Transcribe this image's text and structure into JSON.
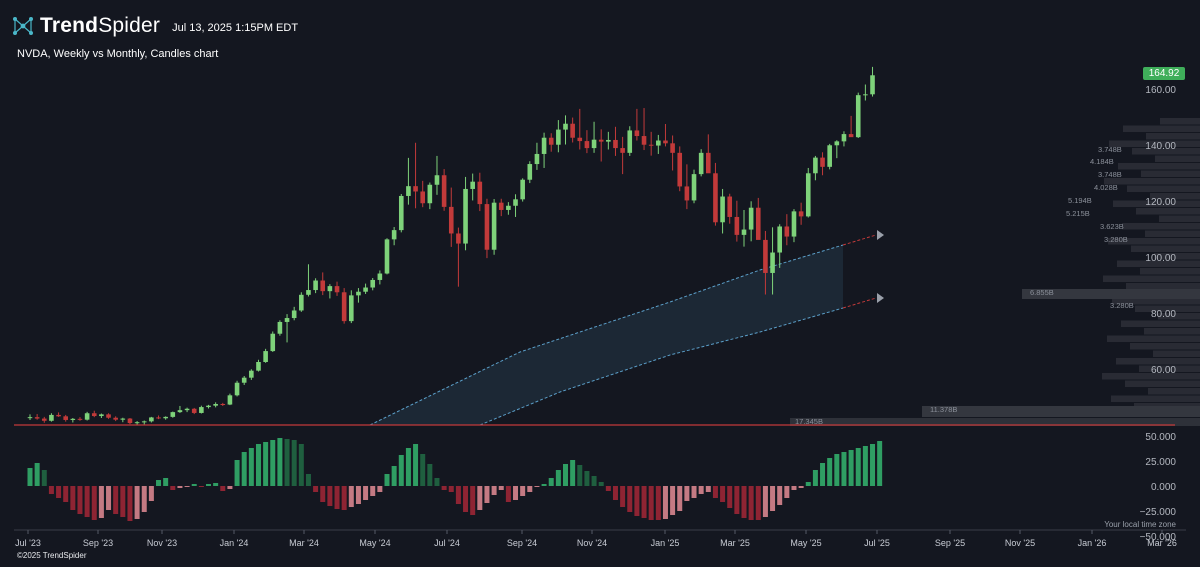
{
  "brand": {
    "name_prefix": "Trend",
    "name_suffix": "Spider",
    "icon": "spider-network-icon"
  },
  "header": {
    "datetime": "Jul 13, 2025 1:15PM EDT",
    "subtitle": "NVDA, Weekly vs Monthly, Candles chart"
  },
  "footer": {
    "copyright": "©2025 TrendSpider",
    "timezone_note": "Your local time zone"
  },
  "colors": {
    "up": "#7ed27a",
    "down": "#c23a3a",
    "hist_up": "#2f9e63",
    "hist_up_fade": "#1f5f3f",
    "hist_down": "#8e2433",
    "hist_down_fade": "#c47a83",
    "channel": "#1d2b3a",
    "volume_profile": "#2b2e36"
  },
  "chart_data": {
    "type": "candlestick",
    "title": "NVDA, Weekly vs Monthly, Candles chart",
    "last_price": "164.92",
    "ylim": [
      40,
      170
    ],
    "y_ticks": [
      "160.00",
      "140.00",
      "120.00",
      "100.00",
      "80.00",
      "60.00"
    ],
    "x_ticks": [
      "Jul '23",
      "Sep '23",
      "Nov '23",
      "Jan '24",
      "Mar '24",
      "May '24",
      "Jul '24",
      "Sep '24",
      "Nov '24",
      "Jan '25",
      "Mar '25",
      "May '25",
      "Jul '25",
      "Sep '25",
      "Nov '25",
      "Jan '26",
      "Mar '26"
    ],
    "candles": [
      [
        42.5,
        43.8,
        41.8,
        42.8
      ],
      [
        42.8,
        43.9,
        41.9,
        42.3
      ],
      [
        42.3,
        42.9,
        40.8,
        41.5
      ],
      [
        41.5,
        44.2,
        41.2,
        43.6
      ],
      [
        43.6,
        44.5,
        42.9,
        43.1
      ],
      [
        43.1,
        43.6,
        41.2,
        41.8
      ],
      [
        41.8,
        42.5,
        40.9,
        42.2
      ],
      [
        42.2,
        42.8,
        41.5,
        41.9
      ],
      [
        41.9,
        44.7,
        41.6,
        44.2
      ],
      [
        44.2,
        45.1,
        42.8,
        43.2
      ],
      [
        43.2,
        44.1,
        42.5,
        43.8
      ],
      [
        43.8,
        44.2,
        42.2,
        42.6
      ],
      [
        42.6,
        43.1,
        41.4,
        41.9
      ],
      [
        41.9,
        42.6,
        41.0,
        42.3
      ],
      [
        42.3,
        42.5,
        40.3,
        40.7
      ],
      [
        40.7,
        41.4,
        40.1,
        41.0
      ],
      [
        41.0,
        41.6,
        40.2,
        41.3
      ],
      [
        41.3,
        42.9,
        40.9,
        42.7
      ],
      [
        42.7,
        43.4,
        42.1,
        42.4
      ],
      [
        42.4,
        43.1,
        41.9,
        42.9
      ],
      [
        42.9,
        44.8,
        42.6,
        44.6
      ],
      [
        44.6,
        46.8,
        44.3,
        45.3
      ],
      [
        45.3,
        46.2,
        44.6,
        45.8
      ],
      [
        45.8,
        46.1,
        43.9,
        44.3
      ],
      [
        44.3,
        46.9,
        44.1,
        46.4
      ],
      [
        46.4,
        47.2,
        45.9,
        46.9
      ],
      [
        46.9,
        48.1,
        46.3,
        47.5
      ],
      [
        47.5,
        47.9,
        46.8,
        47.3
      ],
      [
        47.3,
        51.2,
        47.1,
        50.6
      ],
      [
        50.6,
        55.8,
        50.2,
        55.1
      ],
      [
        55.1,
        57.5,
        54.3,
        56.9
      ],
      [
        56.9,
        59.9,
        56.1,
        59.4
      ],
      [
        59.4,
        63.3,
        59.1,
        62.5
      ],
      [
        62.5,
        67.2,
        62.2,
        66.4
      ],
      [
        66.4,
        73.4,
        66.1,
        72.6
      ],
      [
        72.6,
        77.4,
        71.9,
        76.8
      ],
      [
        76.8,
        79.6,
        69.5,
        78.2
      ],
      [
        78.2,
        82.2,
        77.4,
        80.9
      ],
      [
        80.9,
        87.4,
        80.4,
        86.5
      ],
      [
        86.5,
        97.4,
        85.9,
        88.2
      ],
      [
        88.2,
        92.4,
        87.1,
        91.6
      ],
      [
        91.6,
        94.5,
        86.4,
        87.8
      ],
      [
        87.8,
        90.3,
        85.2,
        89.6
      ],
      [
        89.6,
        91.2,
        86.1,
        87.4
      ],
      [
        87.4,
        88.9,
        76.2,
        77.1
      ],
      [
        77.1,
        88.1,
        76.4,
        86.3
      ],
      [
        86.3,
        88.9,
        83.7,
        87.6
      ],
      [
        87.6,
        90.5,
        86.8,
        89.1
      ],
      [
        89.1,
        92.5,
        88.1,
        91.8
      ],
      [
        91.8,
        95.2,
        90.2,
        94.1
      ],
      [
        94.1,
        106.7,
        93.8,
        106.3
      ],
      [
        106.3,
        110.7,
        104.2,
        109.6
      ],
      [
        109.6,
        122.5,
        108.8,
        121.8
      ],
      [
        121.8,
        135.4,
        118.7,
        125.3
      ],
      [
        125.3,
        140.8,
        117.4,
        123.4
      ],
      [
        123.4,
        127.2,
        117.8,
        119.2
      ],
      [
        119.2,
        126.6,
        117.1,
        125.8
      ],
      [
        125.8,
        136.1,
        122.2,
        129.2
      ],
      [
        129.2,
        131.4,
        116.5,
        117.9
      ],
      [
        117.9,
        124.8,
        103.6,
        108.4
      ],
      [
        108.4,
        110.5,
        89.4,
        104.8
      ],
      [
        104.8,
        128.6,
        102.4,
        124.3
      ],
      [
        124.3,
        129.8,
        120.2,
        126.9
      ],
      [
        126.9,
        130.1,
        116.4,
        118.9
      ],
      [
        118.9,
        120.8,
        99.6,
        102.6
      ],
      [
        102.6,
        120.7,
        100.8,
        119.4
      ],
      [
        119.4,
        120.8,
        114.6,
        116.8
      ],
      [
        116.8,
        119.6,
        115.1,
        118.3
      ],
      [
        118.3,
        122.4,
        114.3,
        120.6
      ],
      [
        120.6,
        128.1,
        119.8,
        127.6
      ],
      [
        127.6,
        134.2,
        126.4,
        133.2
      ],
      [
        133.2,
        140.8,
        131.1,
        136.8
      ],
      [
        136.8,
        144.4,
        131.8,
        142.6
      ],
      [
        142.6,
        144.2,
        137.6,
        140.1
      ],
      [
        140.1,
        148.9,
        137.4,
        145.5
      ],
      [
        145.5,
        150.6,
        140.2,
        147.6
      ],
      [
        147.6,
        149.8,
        140.9,
        142.6
      ],
      [
        142.6,
        152.9,
        138.4,
        141.4
      ],
      [
        141.4,
        145.3,
        137.1,
        138.9
      ],
      [
        138.9,
        148.3,
        137.2,
        141.9
      ],
      [
        141.9,
        145.6,
        134.1,
        141.2
      ],
      [
        141.2,
        144.7,
        138.4,
        141.8
      ],
      [
        141.8,
        146.5,
        136.1,
        138.9
      ],
      [
        138.9,
        142.9,
        129.6,
        137.2
      ],
      [
        137.2,
        146.7,
        136.1,
        145.2
      ],
      [
        145.2,
        152.9,
        141.6,
        143.2
      ],
      [
        143.2,
        153.2,
        138.2,
        140.1
      ],
      [
        140.1,
        144.7,
        136.2,
        139.8
      ],
      [
        139.8,
        143.6,
        136.8,
        141.6
      ],
      [
        141.6,
        147.5,
        139.5,
        140.6
      ],
      [
        140.6,
        143.4,
        130.9,
        137.2
      ],
      [
        137.2,
        139.5,
        123.5,
        125.2
      ],
      [
        125.2,
        133.1,
        117.1,
        120.2
      ],
      [
        120.2,
        131.2,
        119.2,
        129.6
      ],
      [
        129.6,
        138.5,
        128.8,
        137.2
      ],
      [
        137.2,
        143.8,
        136.1,
        129.9
      ],
      [
        129.9,
        133.6,
        111.2,
        112.4
      ],
      [
        112.4,
        124.3,
        108.4,
        121.6
      ],
      [
        121.6,
        122.6,
        111.9,
        114.3
      ],
      [
        114.3,
        120.1,
        105.5,
        107.9
      ],
      [
        107.9,
        116.8,
        103.7,
        109.8
      ],
      [
        109.8,
        119.9,
        105.6,
        117.6
      ],
      [
        117.6,
        121.1,
        107.2,
        106.1
      ],
      [
        106.1,
        109.3,
        86.6,
        94.3
      ],
      [
        94.3,
        110.6,
        86.6,
        101.6
      ],
      [
        101.6,
        111.7,
        96.1,
        110.9
      ],
      [
        110.9,
        115.3,
        104.2,
        107.3
      ],
      [
        107.3,
        117.1,
        105.3,
        116.3
      ],
      [
        116.3,
        119.4,
        111.5,
        114.5
      ],
      [
        114.5,
        131.8,
        114.1,
        129.9
      ],
      [
        129.9,
        136.1,
        127.4,
        135.5
      ],
      [
        135.5,
        137.4,
        129.2,
        132.2
      ],
      [
        132.2,
        140.4,
        131.3,
        139.9
      ],
      [
        139.9,
        141.7,
        135.3,
        141.3
      ],
      [
        141.3,
        144.9,
        139.5,
        143.9
      ],
      [
        143.9,
        150.4,
        143.2,
        142.8
      ],
      [
        142.8,
        158.7,
        142.5,
        157.8
      ],
      [
        157.8,
        161.6,
        155.9,
        158.1
      ],
      [
        158.1,
        167.9,
        157.3,
        164.9
      ]
    ],
    "oscillator": {
      "ylim": [
        -37,
        50
      ],
      "y_ticks": [
        "50.000",
        "25.000",
        "0.000",
        "−25.000",
        "−50.000"
      ],
      "values": [
        18,
        23,
        16,
        -8,
        -12,
        -16,
        -24,
        -28,
        -31,
        -34,
        -32,
        -24,
        -28,
        -31,
        -35,
        -33,
        -26,
        -15,
        6,
        8,
        -4,
        -2,
        -1,
        2,
        -1,
        2,
        3,
        -5,
        -3,
        26,
        34,
        38,
        42,
        44,
        46,
        48,
        47,
        46,
        42,
        12,
        -6,
        -16,
        -20,
        -23,
        -24,
        -21,
        -18,
        -14,
        -10,
        -6,
        12,
        20,
        31,
        38,
        42,
        32,
        22,
        8,
        -4,
        -6,
        -18,
        -26,
        -29,
        -24,
        -17,
        -9,
        -4,
        -16,
        -14,
        -10,
        -6,
        -1,
        2,
        8,
        16,
        22,
        26,
        21,
        15,
        10,
        4,
        -5,
        -14,
        -21,
        -26,
        -30,
        -32,
        -34,
        -34,
        -33,
        -29,
        -25,
        -15,
        -12,
        -8,
        -6,
        -12,
        -16,
        -22,
        -28,
        -32,
        -34,
        -34,
        -31,
        -25,
        -19,
        -12,
        -4,
        -2,
        4,
        16,
        23,
        28,
        32,
        34,
        36,
        38,
        40,
        42,
        45
      ]
    },
    "volume_profile_labels": [
      "3.748B",
      "4.184B",
      "3.748B",
      "4.028B",
      "5.194B",
      "5.215B",
      "3.623B",
      "3.280B",
      "6.855B",
      "3.280B",
      "11.378B",
      "17.345B"
    ]
  }
}
